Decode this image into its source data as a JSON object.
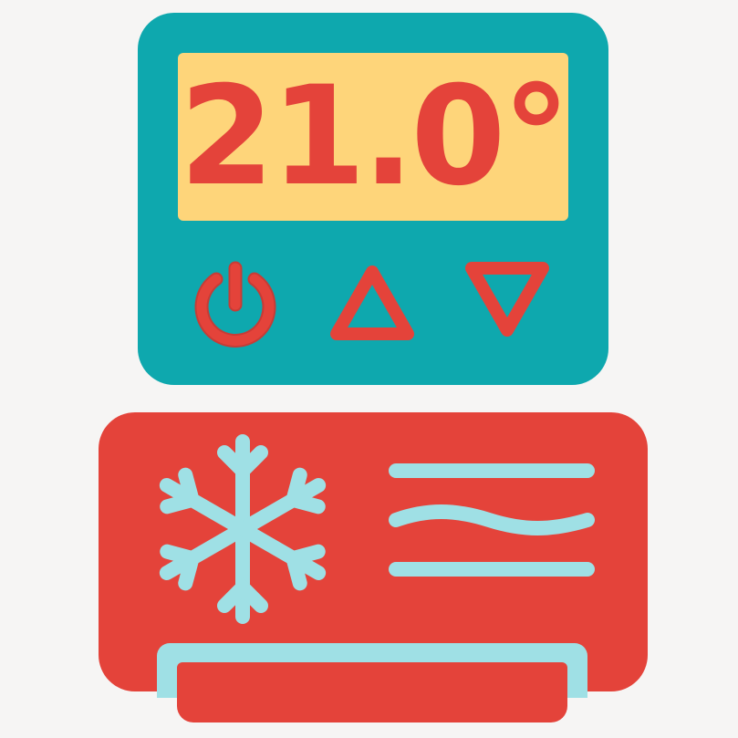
{
  "thermostat": {
    "temperature_display": "21.0°",
    "buttons": {
      "power": "power-icon",
      "up": "triangle-up-icon",
      "down": "triangle-down-icon"
    }
  },
  "air_conditioner": {
    "icon": "snowflake-icon",
    "airflow_icon": "airflow-lines-icon"
  },
  "colors": {
    "background": "#f6f5f4",
    "thermostat_body": "#0ea8ae",
    "display": "#fed57a",
    "accent_red": "#e4433a",
    "ice_blue": "#9fe0e5"
  }
}
